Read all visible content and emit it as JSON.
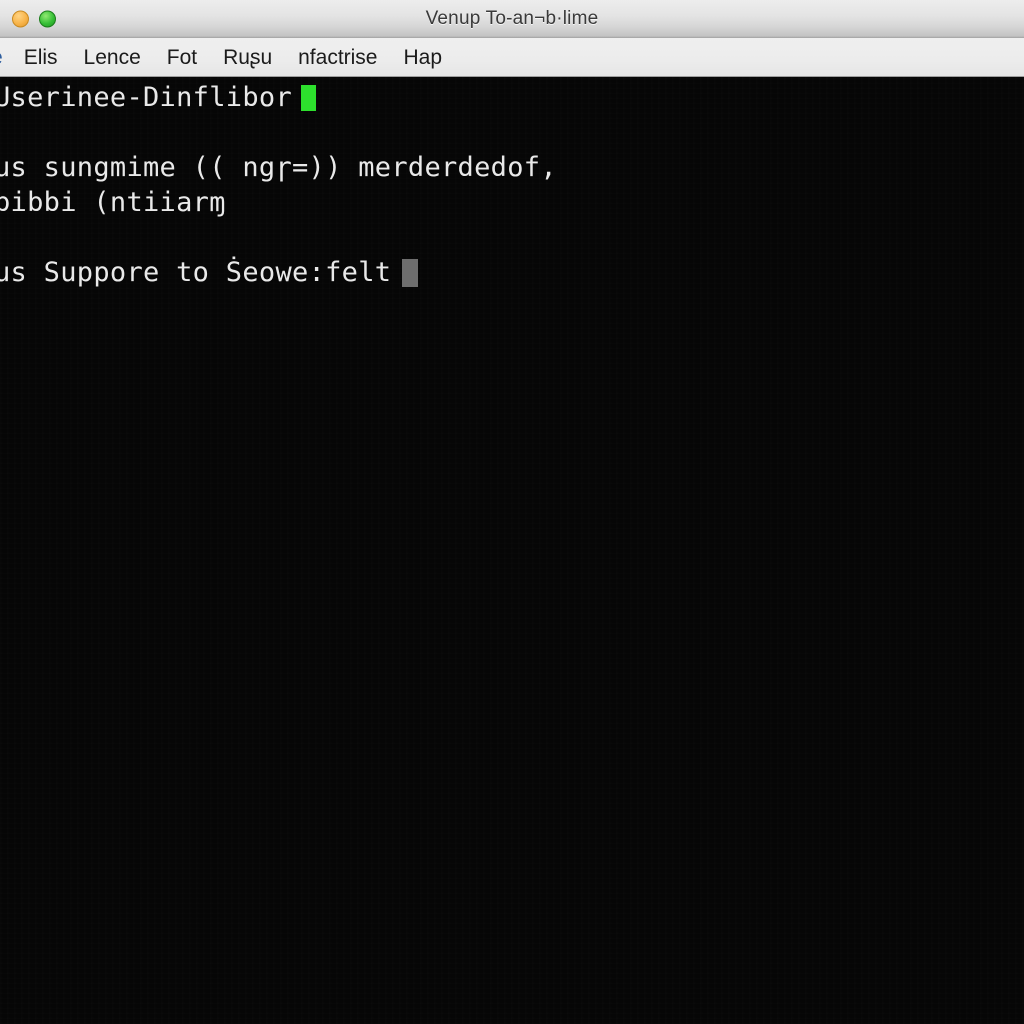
{
  "window": {
    "title": "Venup To-an¬b·lime",
    "controls": [
      {
        "name": "minimize-button",
        "color": "#f8b44a",
        "label": "minimize"
      },
      {
        "name": "zoom-button",
        "color": "#37bf37",
        "label": "zoom"
      }
    ]
  },
  "menubar": {
    "items": [
      {
        "label": "e"
      },
      {
        "label": "Elis"
      },
      {
        "label": "Lence"
      },
      {
        "label": "Fot"
      },
      {
        "label": "Ruʂu"
      },
      {
        "label": "nfactrise"
      },
      {
        "label": "Hap"
      }
    ]
  },
  "terminal": {
    "colors": {
      "background": "#060606",
      "foreground": "#e9e9e9",
      "cursor_active": "#2de02d",
      "cursor_inactive": "#6e6e6e"
    },
    "lines": [
      {
        "text": "Userinee-Dinflibor",
        "cursor": "green"
      },
      {
        "text": "",
        "cursor": "none"
      },
      {
        "text": "us sungmime (( ngɼ=)) merderdedof,",
        "cursor": "none"
      },
      {
        "text": "bibbi (ntiiarɱ",
        "cursor": "none"
      },
      {
        "text": "",
        "cursor": "none"
      },
      {
        "text": "us Suppore to Ṡeowe:felt",
        "cursor": "gray"
      }
    ]
  }
}
